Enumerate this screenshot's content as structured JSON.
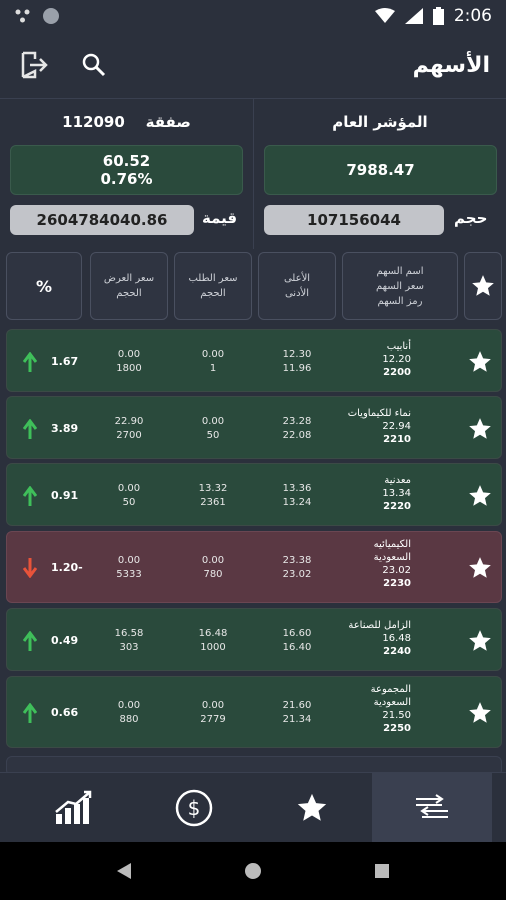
{
  "status": {
    "time": "2:06"
  },
  "appbar": {
    "title": "الأسهم"
  },
  "summary": {
    "index_label": "المؤشر العام",
    "index_value": "7988.47",
    "deals_label": "صفقة",
    "deals_value": "112090",
    "change_value": "60.52",
    "change_pct": "0.76%",
    "volume_label": "حجم",
    "volume_value": "107156044",
    "value_label": "قيمة",
    "value_value": "2604784040.86"
  },
  "table_header": {
    "name_line1": "اسم السهم",
    "name_line2": "سعر السهم",
    "name_line3": "رمز السهم",
    "high_low_1": "الأعلى",
    "high_low_2": "الأدنى",
    "bid_1": "سعر الطلب",
    "bid_2": "الحجم",
    "ask_1": "سعر العرض",
    "ask_2": "الحجم",
    "pct": "%"
  },
  "rows": [
    {
      "name": "أنابيب",
      "name2": "",
      "price": "12.20",
      "symbol": "2200",
      "high": "12.30",
      "low": "11.96",
      "bid": "0.00",
      "bid_vol": "1",
      "ask": "0.00",
      "ask_vol": "1800",
      "pct": "1.67",
      "dir": "up"
    },
    {
      "name": "نماء للكيماويات",
      "name2": "",
      "price": "22.94",
      "symbol": "2210",
      "high": "23.28",
      "low": "22.08",
      "bid": "0.00",
      "bid_vol": "50",
      "ask": "22.90",
      "ask_vol": "2700",
      "pct": "3.89",
      "dir": "up"
    },
    {
      "name": "معدنية",
      "name2": "",
      "price": "13.34",
      "symbol": "2220",
      "high": "13.36",
      "low": "13.24",
      "bid": "13.32",
      "bid_vol": "2361",
      "ask": "0.00",
      "ask_vol": "50",
      "pct": "0.91",
      "dir": "up"
    },
    {
      "name": "الكيميائيه",
      "name2": "السعودية",
      "price": "23.02",
      "symbol": "2230",
      "high": "23.38",
      "low": "23.02",
      "bid": "0.00",
      "bid_vol": "780",
      "ask": "0.00",
      "ask_vol": "5333",
      "pct": "1.20-",
      "dir": "down"
    },
    {
      "name": "الزامل للصناعة",
      "name2": "",
      "price": "16.48",
      "symbol": "2240",
      "high": "16.60",
      "low": "16.40",
      "bid": "16.48",
      "bid_vol": "1000",
      "ask": "16.58",
      "ask_vol": "303",
      "pct": "0.49",
      "dir": "up"
    },
    {
      "name": "المجموعة",
      "name2": "السعودية",
      "price": "21.50",
      "symbol": "2250",
      "high": "21.60",
      "low": "21.34",
      "bid": "0.00",
      "bid_vol": "2779",
      "ask": "0.00",
      "ask_vol": "880",
      "pct": "0.66",
      "dir": "up"
    }
  ],
  "colors": {
    "up": "#3fbf5a",
    "down": "#e8533a",
    "bg": "#2b303c"
  }
}
